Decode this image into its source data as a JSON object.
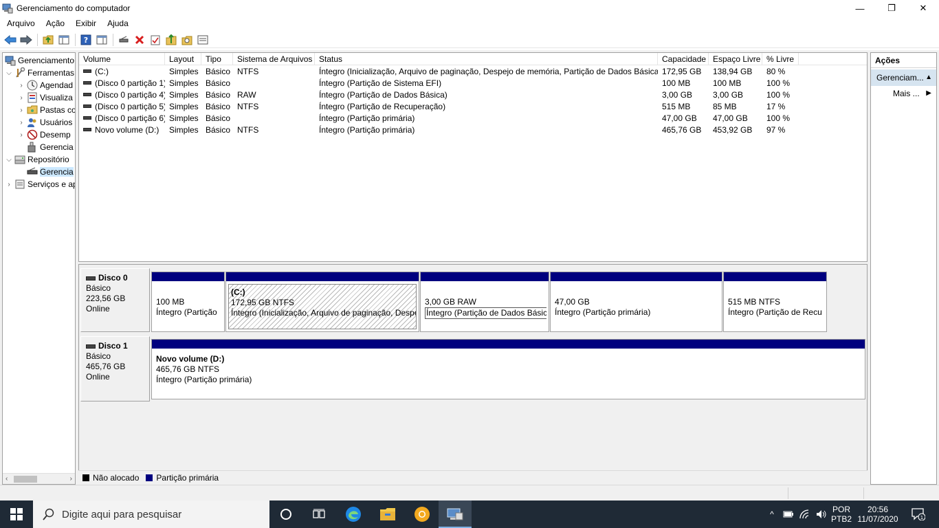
{
  "window": {
    "title": "Gerenciamento do computador",
    "controls": {
      "minimize": "—",
      "maximize": "❐",
      "close": "✕"
    }
  },
  "menu": [
    "Arquivo",
    "Ação",
    "Exibir",
    "Ajuda"
  ],
  "toolbar_icons": [
    "back-arrow-icon",
    "forward-arrow-icon",
    "folder-up-icon",
    "show-hide-tree-icon",
    "help-icon",
    "properties-pane-icon",
    "connect-drive-icon",
    "delete-icon",
    "check-icon",
    "folder-export-icon",
    "search-folder-icon",
    "console-view-icon"
  ],
  "tree": [
    {
      "label": "Gerenciamento",
      "expander": "",
      "icon": "computer-management-icon"
    },
    {
      "label": "Ferramentas",
      "expander": "⌵",
      "icon": "tools-icon"
    },
    {
      "label": "Agendad",
      "expander": "›",
      "icon": "clock-icon"
    },
    {
      "label": "Visualiza",
      "expander": "›",
      "icon": "event-viewer-icon"
    },
    {
      "label": "Pastas co",
      "expander": "›",
      "icon": "shared-folder-icon"
    },
    {
      "label": "Usuários",
      "expander": "›",
      "icon": "users-icon"
    },
    {
      "label": "Desemp",
      "expander": "›",
      "icon": "no-entry-icon"
    },
    {
      "label": "Gerencia",
      "expander": "",
      "icon": "device-manager-icon"
    },
    {
      "label": "Repositório",
      "expander": "⌵",
      "icon": "storage-icon"
    },
    {
      "label": "Gerencia",
      "expander": "",
      "icon": "disk-management-icon"
    },
    {
      "label": "Serviços e ap",
      "expander": "›",
      "icon": "services-icon"
    }
  ],
  "tree_scroll": {
    "left": "‹",
    "right": "›"
  },
  "list": {
    "columns": [
      "Volume",
      "Layout",
      "Tipo",
      "Sistema de Arquivos",
      "Status",
      "Capacidade",
      "Espaço Livre",
      "% Livre"
    ],
    "rows": [
      [
        "(C:)",
        "Simples",
        "Básico",
        "NTFS",
        "Íntegro (Inicialização, Arquivo de paginação, Despejo de memória, Partição de Dados Básica)",
        "172,95 GB",
        "138,94 GB",
        "80 %"
      ],
      [
        "(Disco 0 partição 1)",
        "Simples",
        "Básico",
        "",
        "Íntegro (Partição de Sistema EFI)",
        "100 MB",
        "100 MB",
        "100 %"
      ],
      [
        "(Disco 0 partição 4)",
        "Simples",
        "Básico",
        "RAW",
        "Íntegro (Partição de Dados Básica)",
        "3,00 GB",
        "3,00 GB",
        "100 %"
      ],
      [
        "(Disco 0 partição 5)",
        "Simples",
        "Básico",
        "NTFS",
        "Íntegro (Partição de Recuperação)",
        "515 MB",
        "85 MB",
        "17 %"
      ],
      [
        "(Disco 0 partição 6)",
        "Simples",
        "Básico",
        "",
        "Íntegro (Partição primária)",
        "47,00 GB",
        "47,00 GB",
        "100 %"
      ],
      [
        "Novo volume (D:)",
        "Simples",
        "Básico",
        "NTFS",
        "Íntegro (Partição primária)",
        "465,76 GB",
        "453,92 GB",
        "97 %"
      ]
    ]
  },
  "disks": [
    {
      "name": "Disco 0",
      "type": "Básico",
      "size": "223,56 GB",
      "state": "Online",
      "partitions": [
        {
          "name": "",
          "size": "100 MB",
          "status": "Íntegro (Partição"
        },
        {
          "name": "(C:)",
          "size": "172,95 GB NTFS",
          "status": "Íntegro (Inicialização, Arquivo de paginação, Despe"
        },
        {
          "name": "",
          "size": "3,00 GB RAW",
          "status": "Íntegro (Partição de Dados Básica)"
        },
        {
          "name": "",
          "size": "47,00 GB",
          "status": "Íntegro (Partição primária)"
        },
        {
          "name": "",
          "size": "515 MB NTFS",
          "status": "Íntegro (Partição de Recu"
        }
      ]
    },
    {
      "name": "Disco 1",
      "type": "Básico",
      "size": "465,76 GB",
      "state": "Online",
      "partitions": [
        {
          "name": "Novo volume  (D:)",
          "size": "465,76 GB NTFS",
          "status": "Íntegro (Partição primária)"
        }
      ]
    }
  ],
  "legend": [
    {
      "label": "Não alocado",
      "color": "#000000"
    },
    {
      "label": "Partição primária",
      "color": "#00007f"
    }
  ],
  "actions": {
    "header": "Ações",
    "section": "Gerenciam...",
    "section_arrow": "▲",
    "more": "Mais ...",
    "more_arrow": "▶"
  },
  "taskbar": {
    "search_placeholder": "Digite aqui para pesquisar",
    "language": "POR",
    "layout": "PTB2",
    "time": "20:56",
    "date": "11/07/2020",
    "notifications": "1",
    "tray_chevron": "^"
  },
  "colors": {
    "partition_bar": "#00007f",
    "taskbar": "#1f2a36",
    "selection": "#cce8ff"
  }
}
